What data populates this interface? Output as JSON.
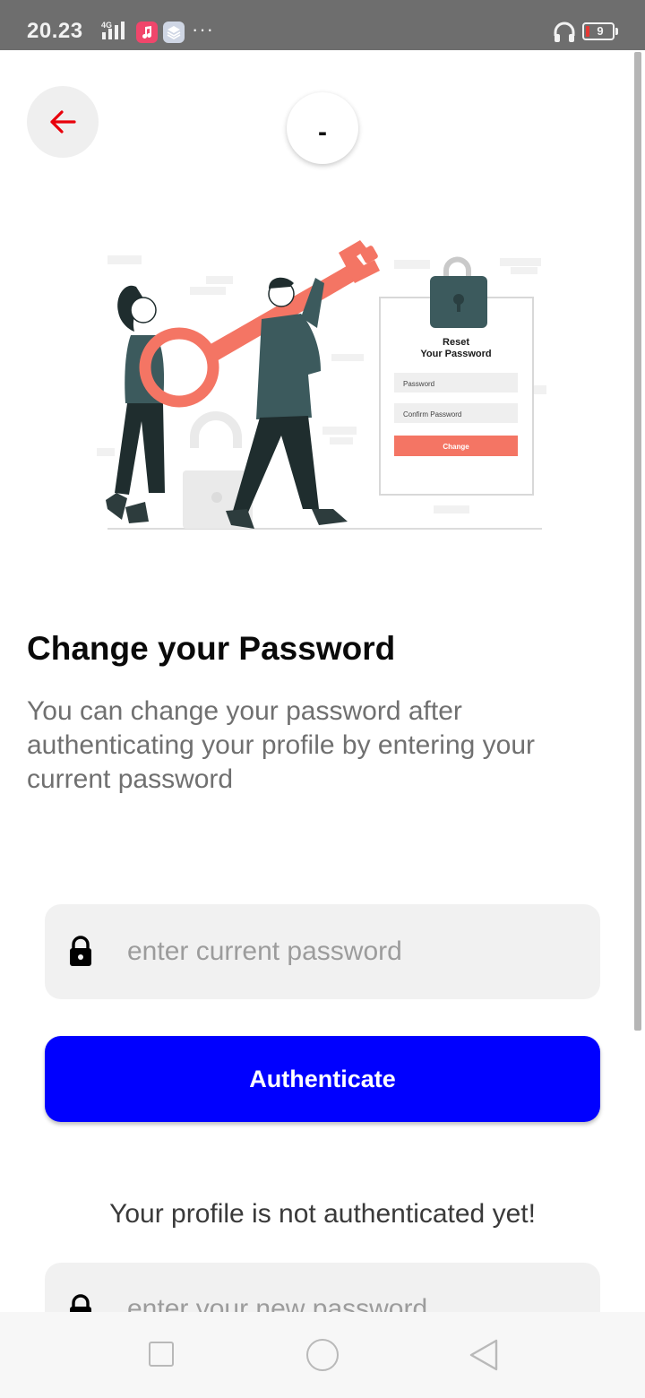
{
  "status_bar": {
    "time": "20.23",
    "network": "4G",
    "more": "···",
    "battery_level": "9"
  },
  "header": {
    "avatar_initial": "-"
  },
  "illustration": {
    "card_title_line1": "Reset",
    "card_title_line2": "Your Password",
    "card_field1": "Password",
    "card_field2": "Confirm Password",
    "card_button": "Change"
  },
  "main": {
    "title": "Change your Password",
    "description": "You can change your password after authenticating your profile by entering your current password",
    "current_password_placeholder": "enter current password",
    "authenticate_label": "Authenticate",
    "auth_status": "Your profile is not authenticated yet!",
    "new_password_placeholder": "enter your new password"
  },
  "colors": {
    "accent": "#0000ff",
    "back_arrow": "#e8000b",
    "illustration_coral": "#f47564",
    "illustration_dark": "#3c5a5d"
  }
}
